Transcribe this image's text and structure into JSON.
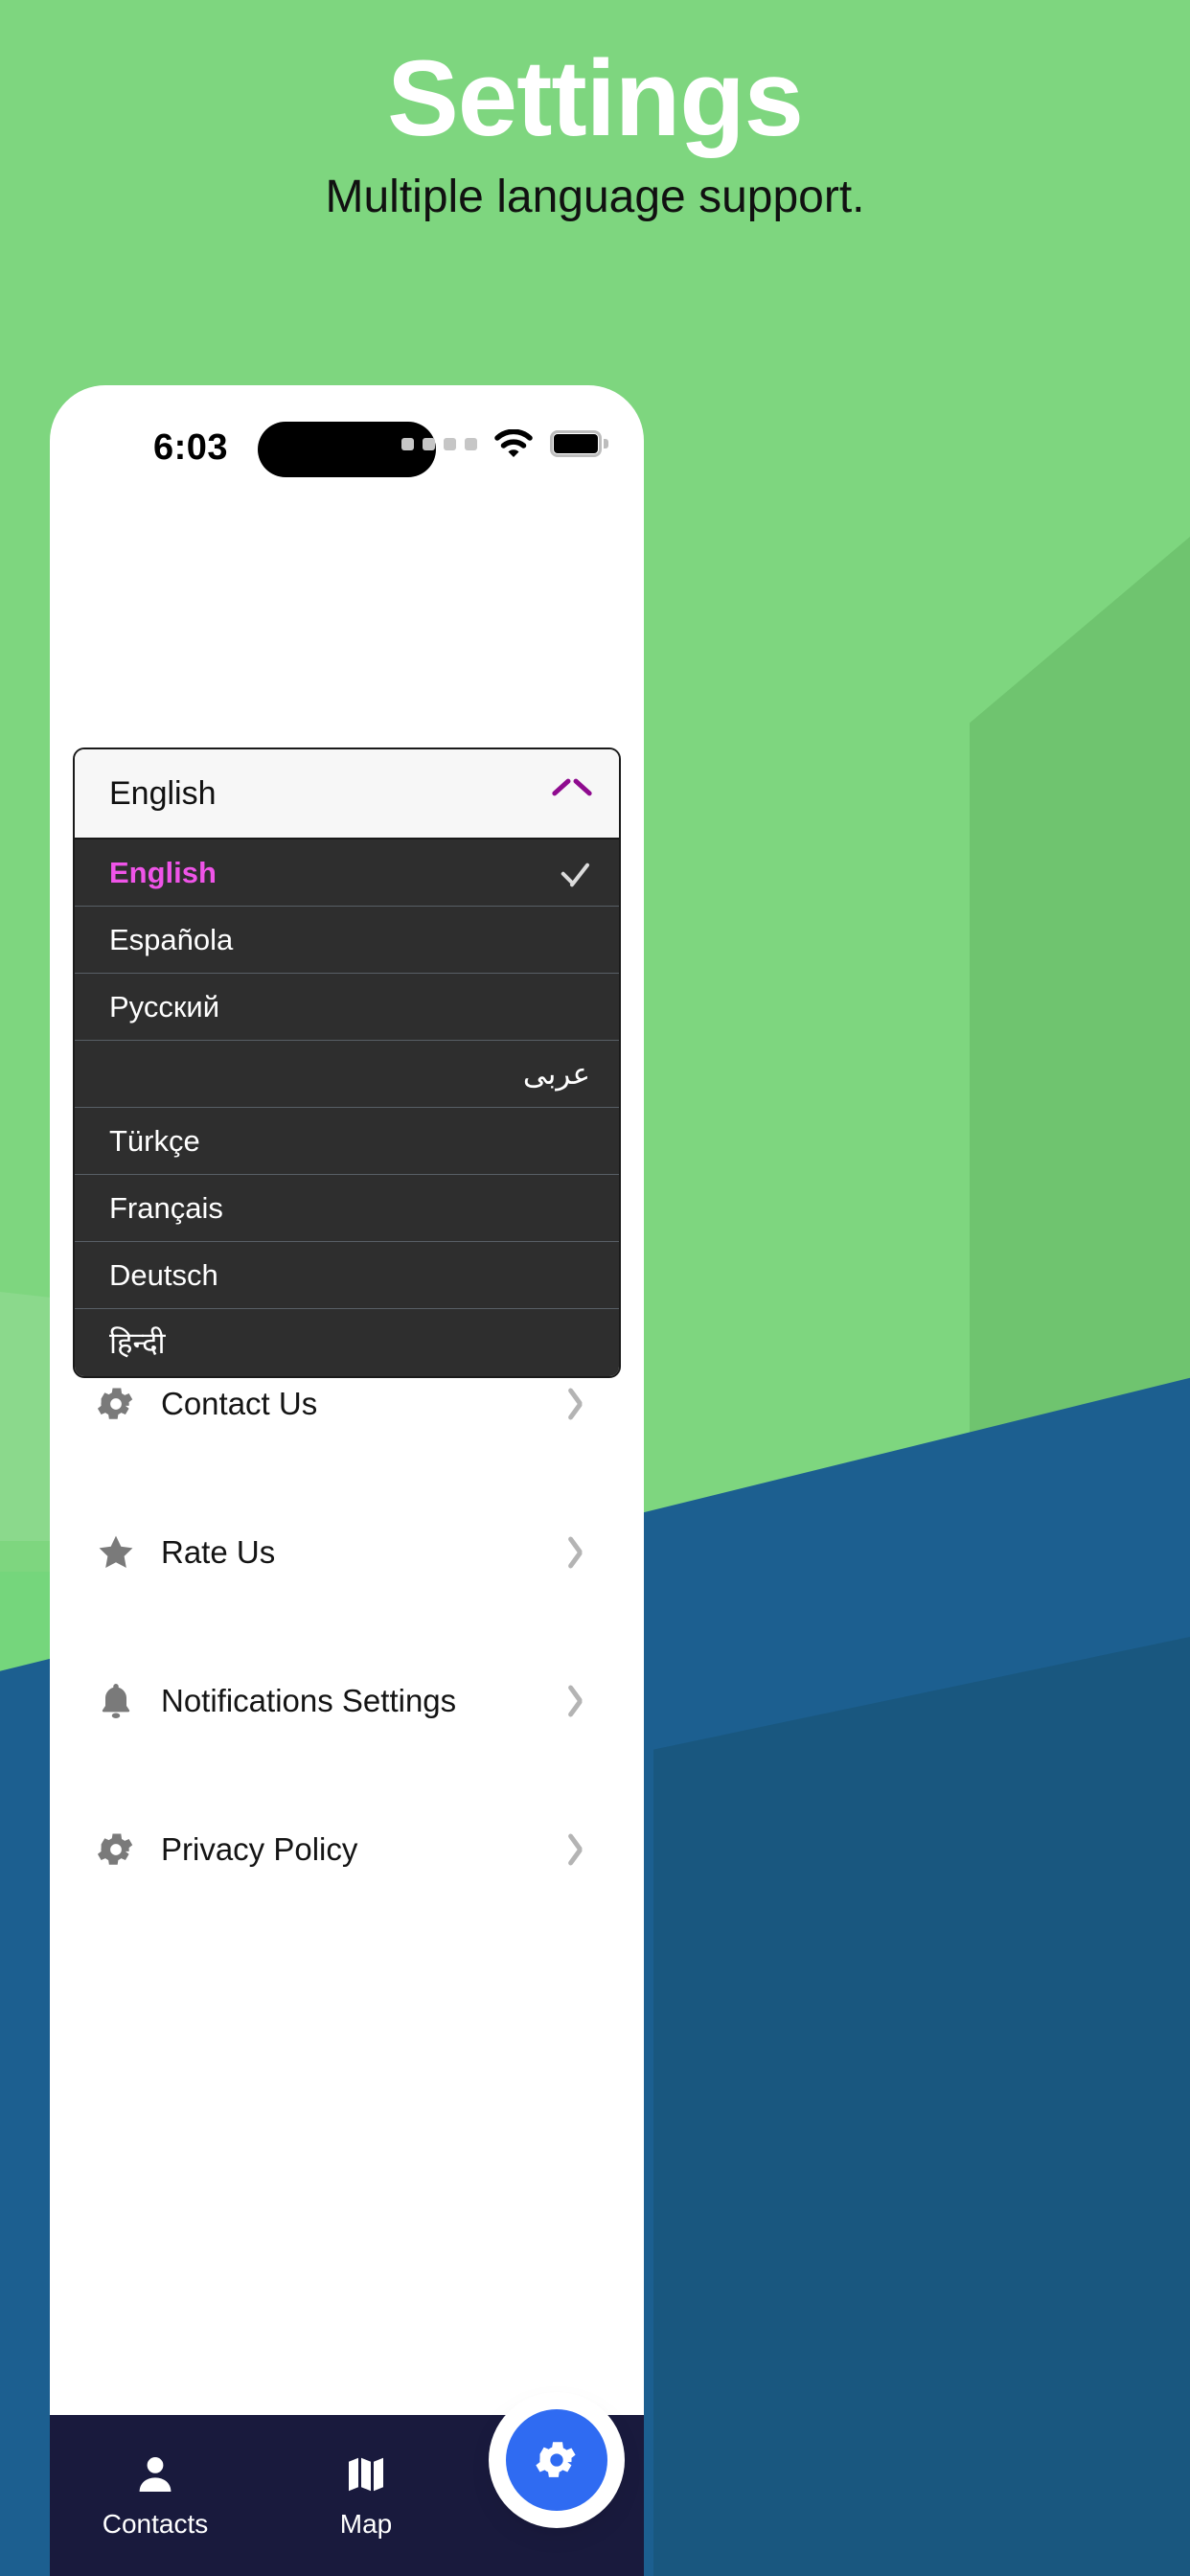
{
  "header": {
    "title": "Settings",
    "subtitle": "Multiple language support."
  },
  "colors": {
    "background_green": "#7ed67f",
    "background_blue": "#1c5f90",
    "accent_magenta": "#ef54e8",
    "chevron_purple": "#8f0b8f",
    "nav_bar": "#191a3d",
    "fab_blue": "#2f6bf2",
    "dropdown_list_bg": "#2e2e2e"
  },
  "status_bar": {
    "time": "6:03",
    "signal_icon": "signal-dots-icon",
    "wifi_icon": "wifi-icon",
    "battery_icon": "battery-full-icon",
    "dynamic_island": "dynamic-island"
  },
  "language_selector": {
    "selected_value": "English",
    "toggle_icon": "chevron-up-icon",
    "expanded": true,
    "options": [
      {
        "label": "English",
        "selected": true,
        "rtl": false
      },
      {
        "label": "Española",
        "selected": false,
        "rtl": false
      },
      {
        "label": "Русский",
        "selected": false,
        "rtl": false
      },
      {
        "label": "عربى",
        "selected": false,
        "rtl": true
      },
      {
        "label": "Türkçe",
        "selected": false,
        "rtl": false
      },
      {
        "label": "Français",
        "selected": false,
        "rtl": false
      },
      {
        "label": "Deutsch",
        "selected": false,
        "rtl": false
      },
      {
        "label": "हिन्दी",
        "selected": false,
        "rtl": false
      }
    ],
    "selected_check_icon": "check-icon"
  },
  "menu": {
    "items": [
      {
        "label": "Contact Us",
        "icon": "gear-icon",
        "chevron": "chevron-right-icon"
      },
      {
        "label": "Rate Us",
        "icon": "star-icon",
        "chevron": "chevron-right-icon"
      },
      {
        "label": "Notifications Settings",
        "icon": "bell-icon",
        "chevron": "chevron-right-icon"
      },
      {
        "label": "Privacy Policy",
        "icon": "gear-icon",
        "chevron": "chevron-right-icon"
      }
    ]
  },
  "bottom_nav": {
    "items": [
      {
        "label": "Contacts",
        "icon": "person-icon"
      },
      {
        "label": "Map",
        "icon": "map-icon"
      }
    ],
    "fab_icon": "gear-icon"
  }
}
